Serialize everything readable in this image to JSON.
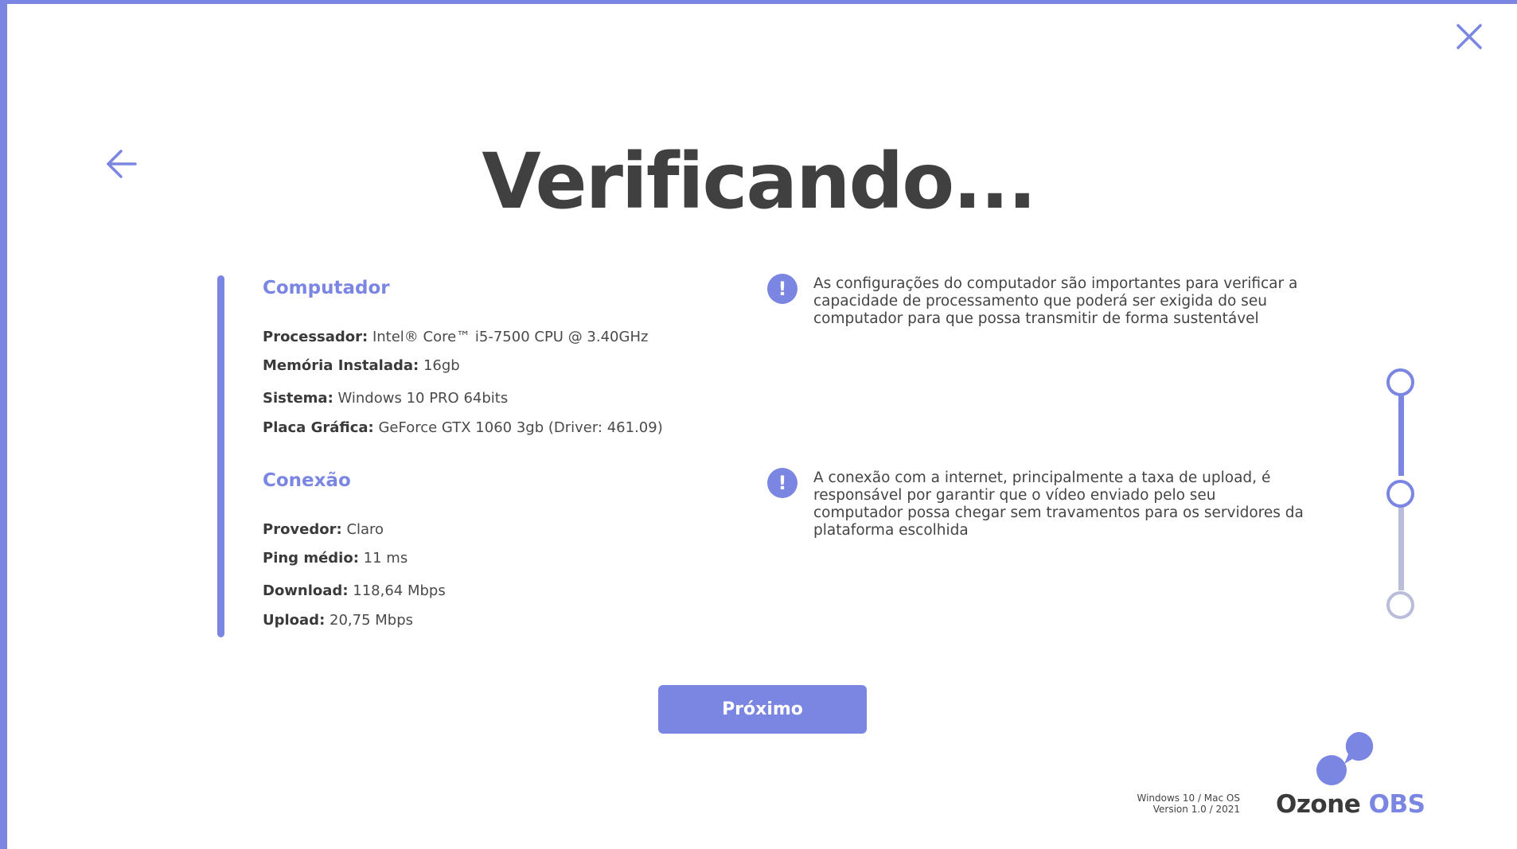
{
  "window": {
    "close_icon": "close-icon",
    "back_icon": "arrow-left-icon"
  },
  "header": {
    "title": "Verificando..."
  },
  "computer": {
    "title": "Computador",
    "specs": [
      {
        "label": "Processador:",
        "value": "Intel® Core™ i5-7500 CPU @ 3.40GHz"
      },
      {
        "label": "Memória Instalada:",
        "value": "16gb"
      },
      {
        "label": "Sistema:",
        "value": "Windows 10 PRO 64bits"
      },
      {
        "label": "Placa Gráfica:",
        "value": "GeForce GTX 1060 3gb (Driver: 461.09)"
      }
    ],
    "info": "As configurações do computador são importantes para verificar a capacidade de processamento que poderá ser exigida do seu computador para que possa transmitir de forma sustentável"
  },
  "connection": {
    "title": "Conexão",
    "specs": [
      {
        "label": "Provedor:",
        "value": "Claro"
      },
      {
        "label": "Ping médio:",
        "value": "11 ms"
      },
      {
        "label": "Download:",
        "value": "118,64 Mbps"
      },
      {
        "label": "Upload:",
        "value": "20,75 Mbps"
      }
    ],
    "info": "A conexão com a internet, principalmente a taxa de upload, é responsável por garantir que o vídeo enviado pelo seu computador possa chegar sem travamentos para os servidores da plataforma escolhida"
  },
  "info_icon_glyph": "!",
  "stepper": {
    "total_steps": 3,
    "completed_steps": 2
  },
  "actions": {
    "next_label": "Próximo"
  },
  "footer": {
    "platform": "Windows 10 / Mac OS",
    "version": "Version 1.0  / 2021",
    "brand_main": "Ozone",
    "brand_accent": "OBS"
  },
  "colors": {
    "accent": "#7b86e2",
    "accent_muted": "#b9bdd9",
    "text_dark": "#404040",
    "background": "#ffffff"
  }
}
